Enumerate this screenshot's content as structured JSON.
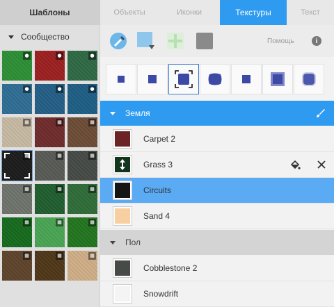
{
  "left_panel": {
    "title": "Шаблоны",
    "category": "Сообщество",
    "swatches": [
      {
        "color": "#2d8f35",
        "icon": "drop-icon"
      },
      {
        "color": "#9c1f1f",
        "icon": "drop-icon"
      },
      {
        "color": "#2e6844",
        "icon": "drop-icon"
      },
      {
        "color": "#2f6d94",
        "icon": "drop-icon"
      },
      {
        "color": "#235e86",
        "icon": "drop-icon"
      },
      {
        "color": "#1e5e84",
        "icon": "drop-icon"
      },
      {
        "color": "#c7b9a2",
        "icon": "grid-icon"
      },
      {
        "color": "#6f2b2b",
        "icon": "grid-icon"
      },
      {
        "color": "#6b4c36",
        "icon": "grid-icon"
      },
      {
        "color": "#1b1b1b",
        "icon": "grid-icon",
        "selected": true
      },
      {
        "color": "#575a55",
        "icon": "grid-icon"
      },
      {
        "color": "#454a45",
        "icon": "grid-icon"
      },
      {
        "color": "#6e746c",
        "icon": "grid-icon"
      },
      {
        "color": "#1f5e2e",
        "icon": "grid-icon"
      },
      {
        "color": "#2e6c37",
        "icon": "grid-icon"
      },
      {
        "color": "#166a1e",
        "icon": "grid-icon"
      },
      {
        "color": "#49a453",
        "icon": "grid-icon"
      },
      {
        "color": "#22751f",
        "icon": "grid-icon"
      },
      {
        "color": "#5e432a",
        "icon": "grid-icon"
      },
      {
        "color": "#4f3618",
        "icon": "grid-icon"
      },
      {
        "color": "#cfae86",
        "icon": "grid-icon"
      }
    ]
  },
  "tabs": [
    {
      "label": "Объекты",
      "active": false
    },
    {
      "label": "Иконки",
      "active": false
    },
    {
      "label": "Текстуры",
      "active": true
    },
    {
      "label": "Текст",
      "active": false
    }
  ],
  "toolbar": {
    "help_label": "Помощь",
    "help_icon": "i"
  },
  "texture_modes": [
    "small-square",
    "square",
    "selected-square",
    "wavy-square",
    "square",
    "large-square",
    "blur-square"
  ],
  "sections": {
    "ground": {
      "title": "Земля",
      "items": [
        {
          "label": "Carpet 2",
          "color": "#6b2326"
        },
        {
          "label": "Grass 3",
          "color": "#12361d"
        },
        {
          "label": "Circuits",
          "color": "#151515"
        },
        {
          "label": "Sand 4",
          "color": "#f8cfa0"
        }
      ]
    },
    "floor": {
      "title": "Пол",
      "items": [
        {
          "label": "Cobblestone 2",
          "color": "#474b48"
        },
        {
          "label": "Snowdrift",
          "color": "#f4f4f4"
        }
      ]
    }
  },
  "colors": {
    "accent": "#2e9bf0",
    "selected_row": "#5aaaf4",
    "mode_icon": "#3d4aa5"
  }
}
